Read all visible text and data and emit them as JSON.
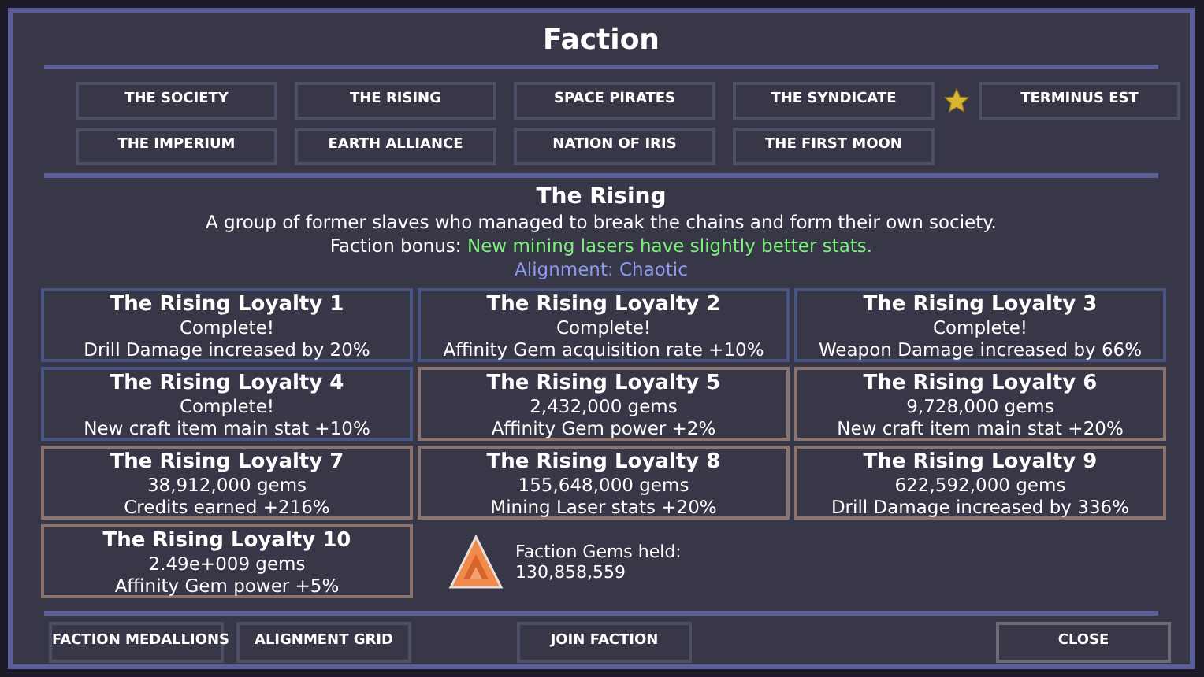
{
  "window": {
    "title": "Faction"
  },
  "factions": [
    {
      "label": "THE SOCIETY",
      "favorite": false
    },
    {
      "label": "THE RISING",
      "favorite": false
    },
    {
      "label": "SPACE PIRATES",
      "favorite": false
    },
    {
      "label": "THE SYNDICATE",
      "favorite": false
    },
    {
      "label": "TERMINUS EST",
      "favorite": true
    },
    {
      "label": "THE IMPERIUM",
      "favorite": false
    },
    {
      "label": "EARTH ALLIANCE",
      "favorite": false
    },
    {
      "label": "NATION OF IRIS",
      "favorite": false
    },
    {
      "label": "THE FIRST MOON",
      "favorite": false
    }
  ],
  "detail": {
    "name": "The Rising",
    "description": "A group of former slaves who managed to break the chains and form their own society.",
    "bonus_label": "Faction bonus:",
    "bonus": "New mining lasers have slightly better stats.",
    "alignment": "Alignment: Chaotic"
  },
  "loyalties": [
    {
      "title": "The Rising Loyalty 1",
      "status": "Complete!",
      "reward": "Drill Damage increased by 20%",
      "complete": true
    },
    {
      "title": "The Rising Loyalty 2",
      "status": "Complete!",
      "reward": "Affinity Gem acquisition rate +10%",
      "complete": true
    },
    {
      "title": "The Rising Loyalty 3",
      "status": "Complete!",
      "reward": "Weapon Damage increased by 66%",
      "complete": true
    },
    {
      "title": "The Rising Loyalty 4",
      "status": "Complete!",
      "reward": "New craft item main stat +10%",
      "complete": true
    },
    {
      "title": "The Rising Loyalty 5",
      "status": "2,432,000 gems",
      "reward": "Affinity Gem power +2%",
      "complete": false
    },
    {
      "title": "The Rising Loyalty 6",
      "status": "9,728,000 gems",
      "reward": "New craft item main stat +20%",
      "complete": false
    },
    {
      "title": "The Rising Loyalty 7",
      "status": "38,912,000 gems",
      "reward": "Credits earned +216%",
      "complete": false
    },
    {
      "title": "The Rising Loyalty 8",
      "status": "155,648,000 gems",
      "reward": "Mining Laser stats +20%",
      "complete": false
    },
    {
      "title": "The Rising Loyalty 9",
      "status": "622,592,000 gems",
      "reward": "Drill Damage increased by 336%",
      "complete": false
    },
    {
      "title": "The Rising Loyalty 10",
      "status": "2.49e+009 gems",
      "reward": "Affinity Gem power +5%",
      "complete": false
    }
  ],
  "gems": {
    "label": "Faction Gems held:",
    "value": "130,858,559"
  },
  "footer": [
    {
      "label": "FACTION MEDALLIONS",
      "kind": "left"
    },
    {
      "label": "ALIGNMENT GRID",
      "kind": "left"
    },
    {
      "label": "JOIN FACTION",
      "kind": "center"
    },
    {
      "label": "CLOSE",
      "kind": "right"
    }
  ]
}
